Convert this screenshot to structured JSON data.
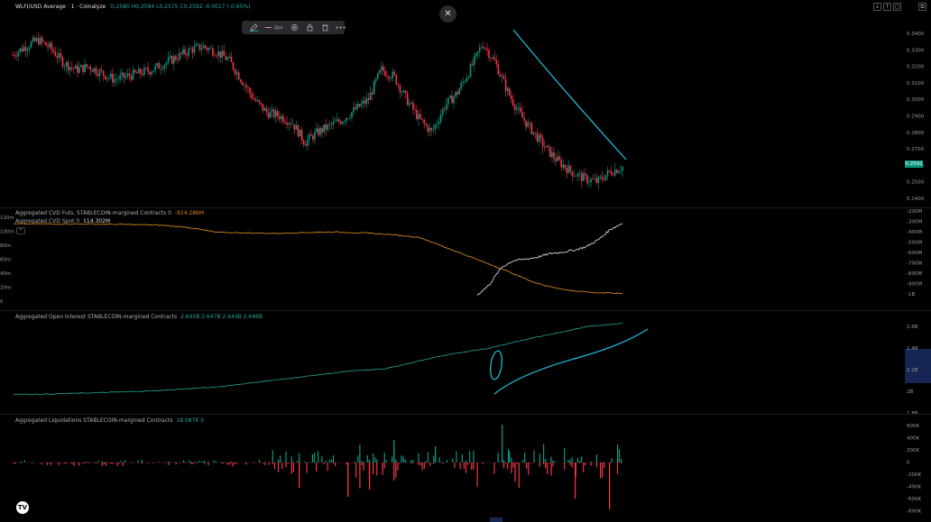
{
  "header": {
    "symbol_title": "WLFI/USD Average · 1 · Coinalyze",
    "ohlc": "O.2580 H0.2594 L0.2575 C0.2592 -0.0017 (-0.65%)"
  },
  "toolbar": {
    "line_width_label": "2px"
  },
  "close_glyph": "✕",
  "price_badge": "0.2592",
  "cvd": {
    "futs_label": "Aggregated CVD Futs, STABLECOIN-margined Contracts 0",
    "futs_value": "-924.286M",
    "spot_label": "Aggregated CVD Spot 0",
    "spot_value": "114.302M",
    "toggle_glyph": "^"
  },
  "oi": {
    "label": "Aggregated Open Interest STABLECOIN-margined Contracts",
    "values": "2.645B 2.647B 2.644B 2.646B"
  },
  "liq": {
    "label": "Aggregated Liquidations STABLECOIN-margined Contracts",
    "values": "18.087K 0"
  },
  "tv_logo_text": "TV",
  "colors": {
    "up": "#089981",
    "down": "#f23645",
    "trendline": "#22b8d6",
    "cvd_futs": "#d4841b",
    "cvd_spot": "#d0d0d0",
    "oi_line": "#26a69a"
  },
  "chart_data": [
    {
      "type": "candlestick",
      "y_ticks": [
        "0.3400",
        "0.3300",
        "0.3200",
        "0.3100",
        "0.3000",
        "0.2900",
        "0.2800",
        "0.2700",
        "0.2600",
        "0.2500",
        "0.2400"
      ],
      "ylim": [
        0.24,
        0.34
      ],
      "last_price": 0.2592,
      "approx_close_path": [
        0.327,
        0.332,
        0.336,
        0.331,
        0.322,
        0.318,
        0.32,
        0.316,
        0.312,
        0.314,
        0.316,
        0.318,
        0.322,
        0.326,
        0.33,
        0.332,
        0.329,
        0.324,
        0.312,
        0.3,
        0.292,
        0.29,
        0.286,
        0.274,
        0.28,
        0.284,
        0.288,
        0.294,
        0.3,
        0.318,
        0.314,
        0.3,
        0.288,
        0.28,
        0.296,
        0.304,
        0.318,
        0.334,
        0.322,
        0.304,
        0.29,
        0.28,
        0.27,
        0.262,
        0.256,
        0.252,
        0.25,
        0.256,
        0.259
      ]
    },
    {
      "type": "line",
      "series": [
        {
          "name": "Aggregated CVD Futs, STABLECOIN-margined Contracts 0",
          "values_M": [
            -300,
            -300,
            -300,
            -302,
            -305,
            -310,
            -330,
            -375,
            -380,
            -385,
            -378,
            -372,
            -380,
            -395,
            -420,
            -520,
            -620,
            -720,
            -830,
            -890,
            -915,
            -924
          ]
        },
        {
          "name": "Aggregated CVD Spot 0",
          "values_M": [
            10,
            25,
            50,
            60,
            62,
            65,
            70,
            72,
            75,
            80,
            90,
            105,
            114
          ]
        }
      ],
      "left_ticks": [
        "120m",
        "100m",
        "80m",
        "60m",
        "40m",
        "20m",
        "0"
      ],
      "right_ticks": [
        "-200M",
        "-300M",
        "-400M",
        "-500M",
        "-600M",
        "-700M",
        "-800M",
        "-900M",
        "-1B"
      ]
    },
    {
      "type": "line",
      "series": [
        {
          "name": "Aggregated Open Interest STABLECOIN-margined Contracts",
          "values_B": [
            1.95,
            1.95,
            1.96,
            1.97,
            1.98,
            2.0,
            2.02,
            2.06,
            2.1,
            2.14,
            2.18,
            2.2,
            2.28,
            2.35,
            2.4,
            2.48,
            2.55,
            2.62,
            2.65
          ]
        }
      ],
      "right_ticks": [
        "2.6B",
        "2.4B",
        "2.2B",
        "2B",
        "1.8B"
      ]
    },
    {
      "type": "bar",
      "series": [
        {
          "name": "Aggregated Liquidations STABLECOIN-margined Contracts",
          "note": "long (red, negative) and short (green, positive) liquidation bars"
        }
      ],
      "right_ticks": [
        "600K",
        "400K",
        "200K",
        "0",
        "-200K",
        "-400K",
        "-600K",
        "-800K"
      ]
    }
  ]
}
